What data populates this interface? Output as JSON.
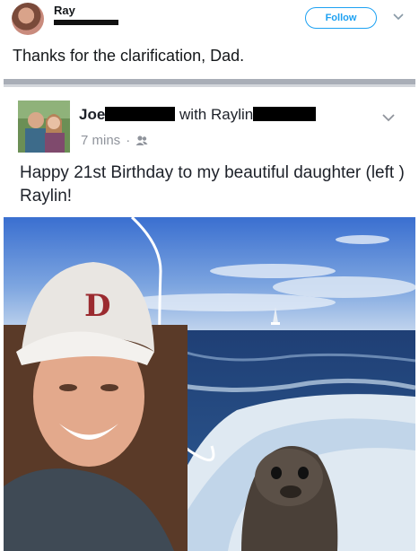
{
  "tweet": {
    "author_name": "Ray",
    "follow_label": "Follow",
    "text": "Thanks for the clarification, Dad."
  },
  "fb_post": {
    "author_first": "Joe",
    "with_label": "with Raylin",
    "time": "7 mins",
    "separator": "·",
    "body": "Happy 21st Birthday to my beautiful daughter (left ) Raylin!",
    "cap_logo": "D"
  },
  "colors": {
    "twitter_blue": "#1da1f2",
    "fb_text": "#1d2129",
    "fb_meta": "#90949c"
  },
  "icons": [
    "chevron-down-icon",
    "friends-icon"
  ]
}
